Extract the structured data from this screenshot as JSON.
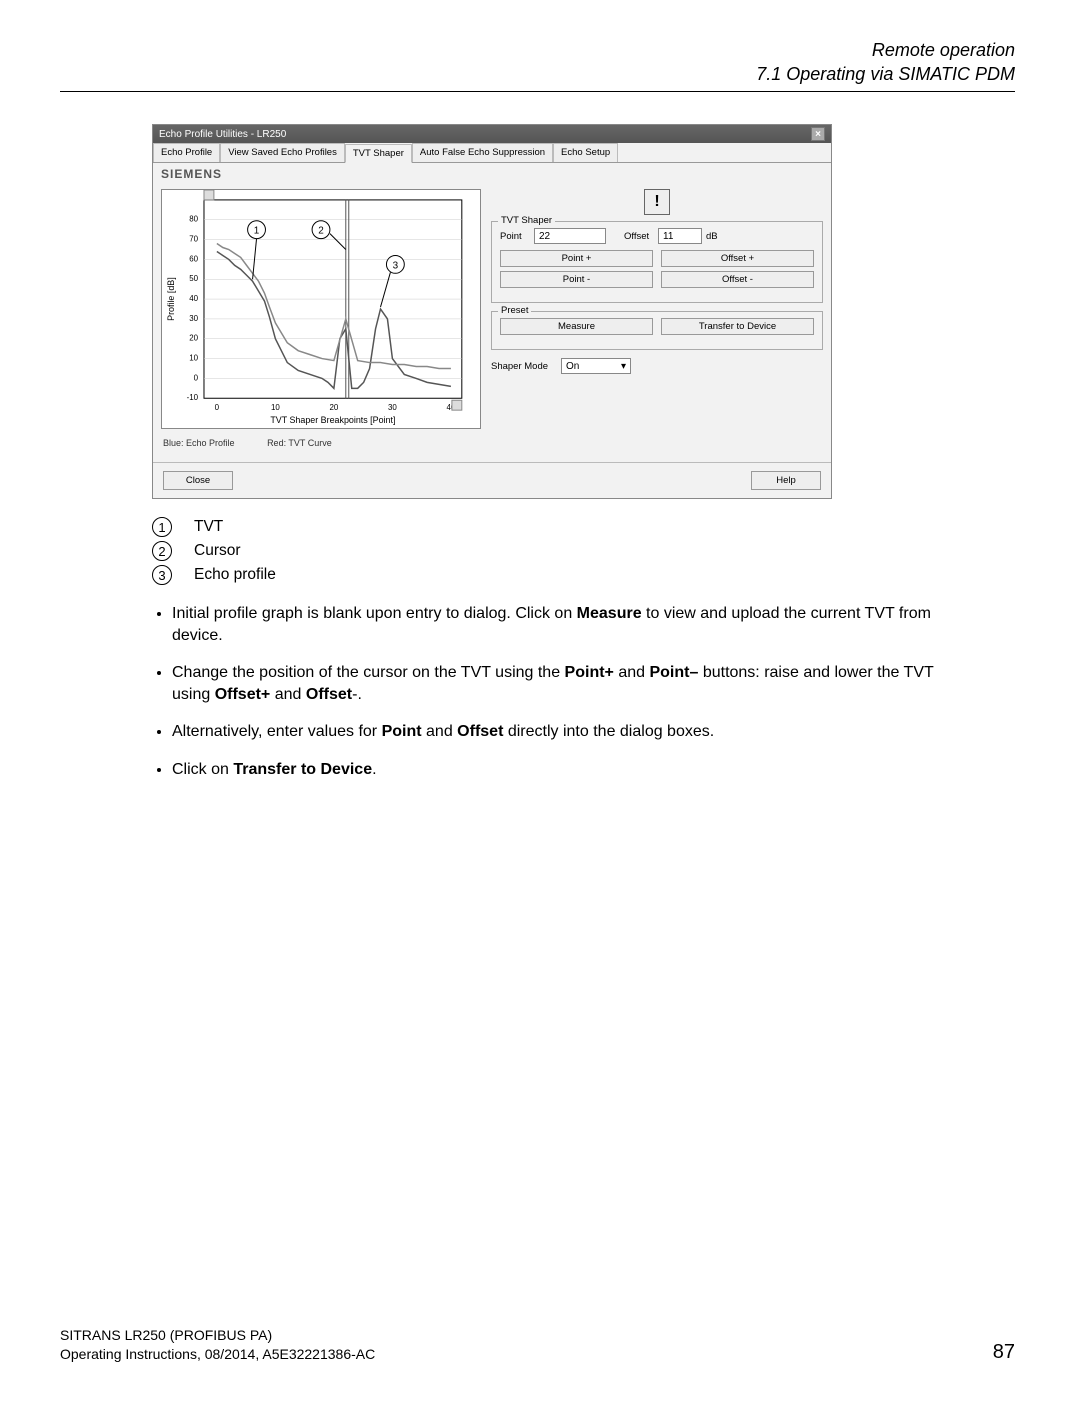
{
  "header": {
    "chapter": "Remote operation",
    "section": "7.1 Operating via SIMATIC PDM"
  },
  "dialog": {
    "title": "Echo Profile Utilities - LR250",
    "tabs": [
      "Echo Profile",
      "View Saved Echo Profiles",
      "TVT Shaper",
      "Auto False Echo Suppression",
      "Echo Setup"
    ],
    "active_tab_index": 2,
    "brand": "SIEMENS",
    "chart": {
      "x_label": "TVT Shaper Breakpoints [Point]",
      "y_label": "Profile [dB]",
      "x_ticks": [
        "0",
        "10",
        "20",
        "30",
        "40"
      ],
      "y_ticks": [
        "-10",
        "0",
        "10",
        "20",
        "30",
        "40",
        "50",
        "60",
        "70",
        "80"
      ]
    },
    "legend": {
      "line1": "Blue: Echo Profile",
      "line2": "Red: TVT Curve"
    },
    "tvt_shaper": {
      "title": "TVT Shaper",
      "point_label": "Point",
      "point_value": "22",
      "offset_label": "Offset",
      "offset_value": "11",
      "db": "dB",
      "point_plus": "Point +",
      "offset_plus": "Offset +",
      "point_minus": "Point -",
      "offset_minus": "Offset -"
    },
    "preset": {
      "title": "Preset",
      "measure": "Measure",
      "transfer": "Transfer to Device"
    },
    "shaper_mode": {
      "label": "Shaper Mode",
      "value": "On"
    },
    "close": "Close",
    "help": "Help"
  },
  "callouts": [
    {
      "num": "1",
      "text": "TVT"
    },
    {
      "num": "2",
      "text": "Cursor"
    },
    {
      "num": "3",
      "text": "Echo profile"
    }
  ],
  "bullets": {
    "b1a": "Initial profile graph is blank upon entry to dialog. Click on ",
    "b1b": "Measure",
    "b1c": " to view and upload the current TVT from device.",
    "b2a": "Change the position of the cursor on the TVT using the ",
    "b2b": "Point+",
    "b2c": " and ",
    "b2d": "Point–",
    "b2e": " buttons: raise and lower the TVT using ",
    "b2f": "Offset+",
    "b2g": " and ",
    "b2h": "Offset",
    "b2i": "-.",
    "b3a": "Alternatively, enter values for ",
    "b3b": "Point",
    "b3c": " and ",
    "b3d": "Offset",
    "b3e": " directly into the dialog boxes.",
    "b4a": "Click on ",
    "b4b": "Transfer to Device",
    "b4c": "."
  },
  "footer": {
    "product": "SITRANS LR250 (PROFIBUS PA)",
    "docinfo": "Operating Instructions, 08/2014, A5E32221386-AC",
    "page": "87"
  },
  "chart_data": {
    "type": "line",
    "title": "TVT Shaper",
    "xlabel": "TVT Shaper Breakpoints [Point]",
    "ylabel": "Profile [dB]",
    "xlim": [
      -2,
      42
    ],
    "ylim": [
      -12,
      85
    ],
    "x_ticks": [
      0,
      10,
      20,
      30,
      40
    ],
    "y_ticks": [
      -10,
      0,
      10,
      20,
      30,
      40,
      50,
      60,
      70,
      80
    ],
    "series": [
      {
        "name": "Echo Profile",
        "color": "blue",
        "x": [
          0,
          1,
          2,
          3,
          4,
          5,
          6,
          7,
          8,
          9,
          10,
          12,
          14,
          16,
          18,
          19,
          20,
          21,
          22,
          23,
          24,
          25,
          26,
          27,
          28,
          29,
          30,
          32,
          34,
          36,
          38,
          40
        ],
        "y": [
          62,
          60,
          58,
          55,
          53,
          50,
          47,
          42,
          38,
          30,
          20,
          8,
          4,
          2,
          0,
          -2,
          -5,
          20,
          25,
          -5,
          -5,
          -2,
          5,
          25,
          35,
          30,
          10,
          2,
          0,
          -2,
          -3,
          -4
        ]
      },
      {
        "name": "TVT Curve",
        "color": "red",
        "x": [
          0,
          1,
          2,
          3,
          4,
          5,
          6,
          7,
          8,
          9,
          10,
          12,
          14,
          16,
          18,
          20,
          22,
          24,
          26,
          28,
          30,
          32,
          34,
          36,
          38,
          40
        ],
        "y": [
          66,
          65,
          63,
          62,
          60,
          58,
          55,
          50,
          44,
          36,
          28,
          18,
          14,
          12,
          10,
          9,
          30,
          9,
          8,
          8,
          7,
          7,
          6,
          6,
          5,
          5
        ]
      }
    ],
    "cursor_x": 22,
    "annotations": [
      {
        "label": "1",
        "x": 7,
        "y": 68
      },
      {
        "label": "2",
        "x": 18,
        "y": 68
      },
      {
        "label": "3",
        "x": 25,
        "y": 48
      }
    ]
  }
}
